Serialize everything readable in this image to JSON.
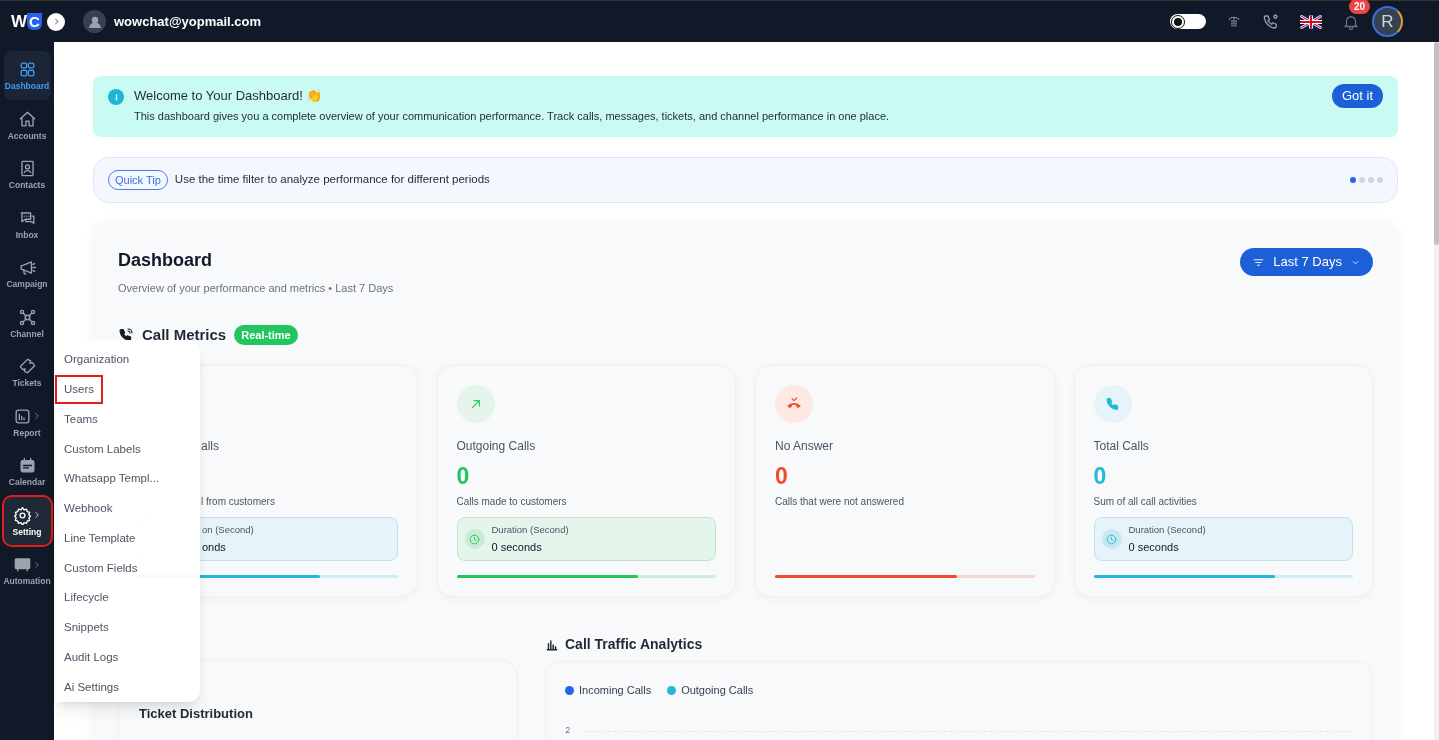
{
  "topbar": {
    "logo_letters": [
      "W",
      "C"
    ],
    "user_email": "wowchat@yopmail.com",
    "notification_count": "20",
    "avatar_initial": "R",
    "theme_toggle_on": false
  },
  "sidebar": {
    "items": [
      {
        "label": "Dashboard",
        "selected": true,
        "submenu": false,
        "highlighted": false
      },
      {
        "label": "Accounts",
        "selected": false,
        "submenu": false,
        "highlighted": false
      },
      {
        "label": "Contacts",
        "selected": false,
        "submenu": false,
        "highlighted": false
      },
      {
        "label": "Inbox",
        "selected": false,
        "submenu": false,
        "highlighted": false
      },
      {
        "label": "Campaign",
        "selected": false,
        "submenu": false,
        "highlighted": false
      },
      {
        "label": "Channel",
        "selected": false,
        "submenu": false,
        "highlighted": false
      },
      {
        "label": "Tickets",
        "selected": false,
        "submenu": false,
        "highlighted": false
      },
      {
        "label": "Report",
        "selected": false,
        "submenu": true,
        "highlighted": false
      },
      {
        "label": "Calendar",
        "selected": false,
        "submenu": false,
        "highlighted": false
      },
      {
        "label": "Setting",
        "selected": false,
        "submenu": true,
        "highlighted": true
      },
      {
        "label": "Automation",
        "selected": false,
        "submenu": true,
        "highlighted": false
      }
    ]
  },
  "settings_menu": {
    "items": [
      {
        "label": "Organization",
        "highlighted": false
      },
      {
        "label": "Users",
        "highlighted": true
      },
      {
        "label": "Teams",
        "highlighted": false
      },
      {
        "label": "Custom Labels",
        "highlighted": false
      },
      {
        "label": "Whatsapp Templ...",
        "highlighted": false
      },
      {
        "label": "Webhook",
        "highlighted": false
      },
      {
        "label": "Line Template",
        "highlighted": false
      },
      {
        "label": "Custom Fields",
        "highlighted": false
      },
      {
        "label": "Lifecycle",
        "highlighted": false
      },
      {
        "label": "Snippets",
        "highlighted": false
      },
      {
        "label": "Audit Logs",
        "highlighted": false
      },
      {
        "label": "Ai Settings",
        "highlighted": false
      }
    ]
  },
  "welcome_banner": {
    "title": "Welcome to Your Dashboard! 👏",
    "text": "This dashboard gives you a complete overview of your communication performance. Track calls, messages, tickets, and channel performance in one place.",
    "button": "Got it"
  },
  "tip_bar": {
    "badge": "Quick Tip",
    "text": "Use the time filter to analyze performance for different periods",
    "dots": [
      {
        "selected": true
      },
      {
        "selected": false
      },
      {
        "selected": false
      },
      {
        "selected": false
      }
    ]
  },
  "dashboard": {
    "title": "Dashboard",
    "subtitle": "Overview of your performance and metrics • Last 7 Days",
    "filter_button": "Last 7 Days",
    "call_metrics": {
      "title": "Call Metrics",
      "badge": "Real-time",
      "cards": [
        {
          "kind": "covered",
          "title": "alls",
          "description": "l from customers",
          "duration_label": "on (Second)",
          "duration_value": "onds",
          "color": "#22b8d8",
          "level": 0.7
        },
        {
          "kind": "outgoing",
          "title": "Outgoing Calls",
          "value": "0",
          "description": "Calls made to customers",
          "duration_label": "Duration (Second)",
          "duration_value": "0 seconds",
          "color": "#22c55e",
          "level": 0.7
        },
        {
          "kind": "missed",
          "title": "No Answer",
          "value": "0",
          "description": "Calls that were not answered",
          "color": "#f04a2e",
          "level": 0.7
        },
        {
          "kind": "total",
          "title": "Total Calls",
          "value": "0",
          "description": "Sum of all call activities",
          "duration_label": "Duration (Second)",
          "duration_value": "0 seconds",
          "color": "#22b8d8",
          "level": 0.7
        }
      ]
    },
    "ticket_distribution": {
      "title": "Ticket Distribution"
    },
    "call_traffic": {
      "title": "Call Traffic Analytics",
      "legend": [
        {
          "label": "Incoming Calls",
          "color": "#2563eb"
        },
        {
          "label": "Outgoing Calls",
          "color": "#22b8d8"
        }
      ],
      "y_tick": "2"
    }
  }
}
